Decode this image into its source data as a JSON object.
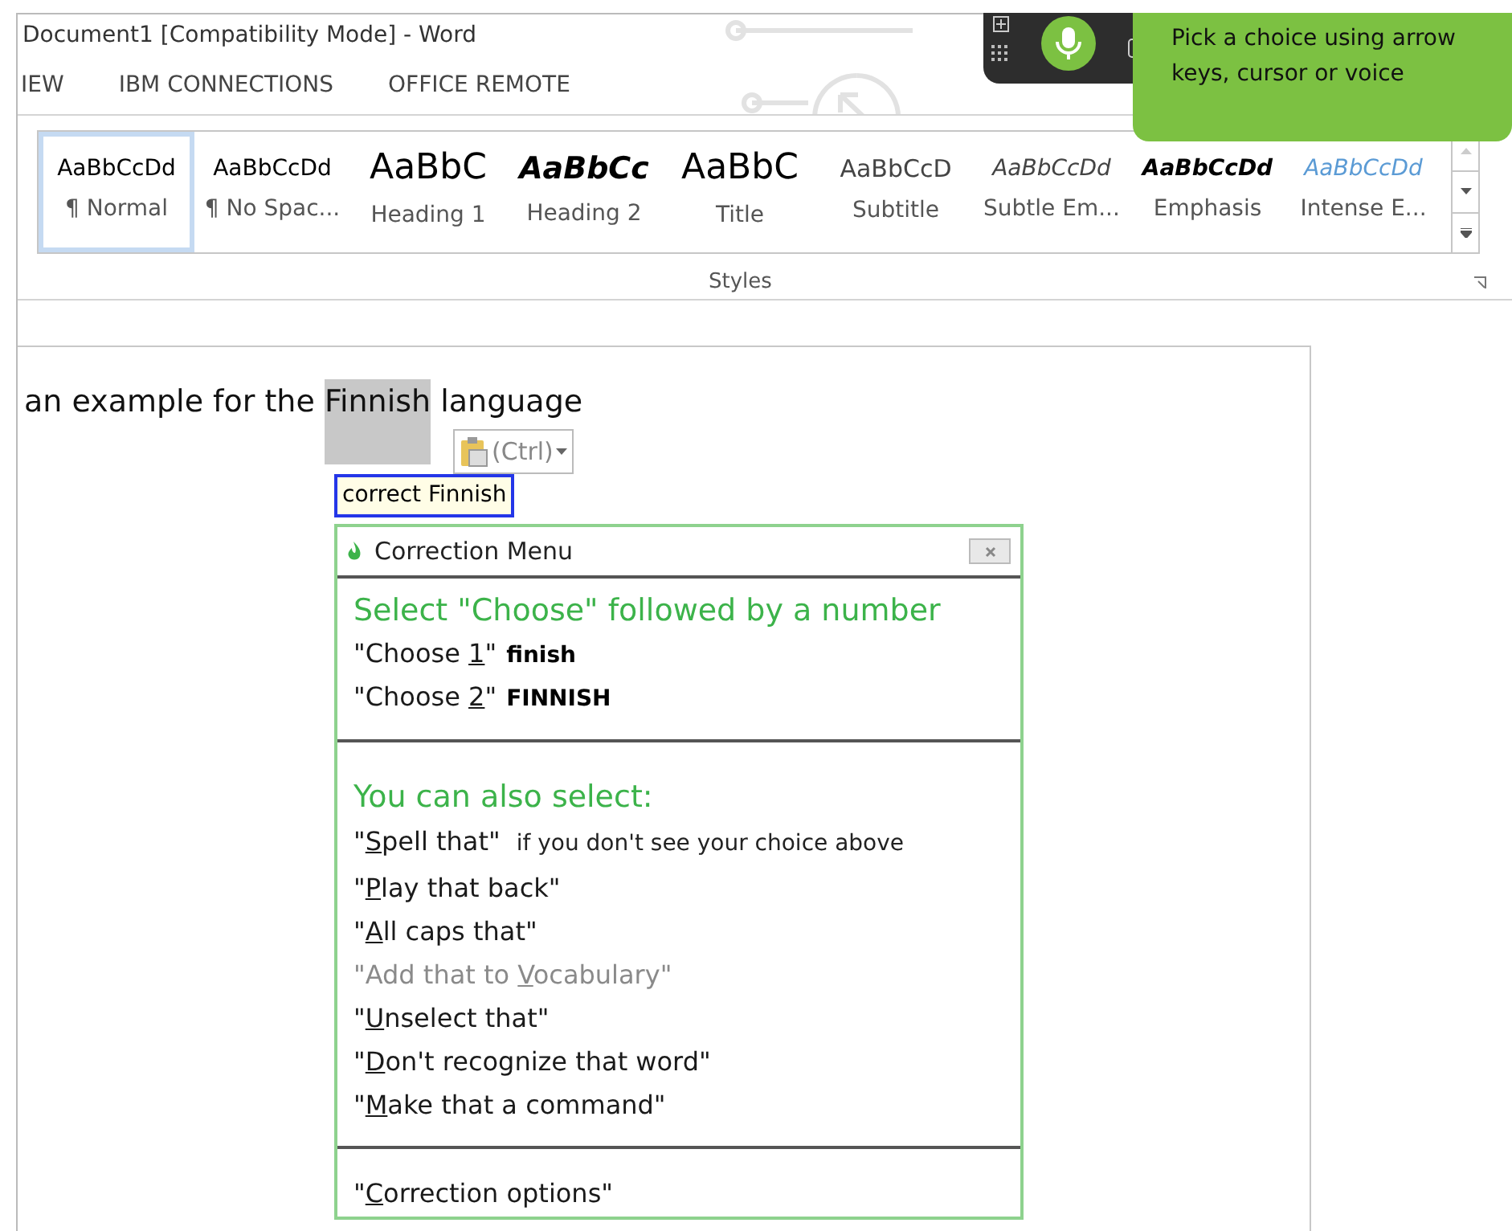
{
  "window": {
    "title": "Document1 [Compatibility Mode] - Word"
  },
  "ribbon_tabs": [
    {
      "label": "IEW",
      "selected": false
    },
    {
      "label": "IBM CONNECTIONS",
      "selected": false
    },
    {
      "label": "OFFICE REMOTE",
      "selected": false
    }
  ],
  "styles": {
    "group_label": "Styles",
    "items": [
      {
        "preview": "AaBbCcDd",
        "name": "¶ Normal",
        "kind": "normal",
        "selected": true
      },
      {
        "preview": "AaBbCcDd",
        "name": "¶ No Spac...",
        "kind": "normal",
        "selected": false
      },
      {
        "preview": "AaBbC",
        "name": "Heading 1",
        "kind": "heading1",
        "selected": false
      },
      {
        "preview": "AaBbCc",
        "name": "Heading 2",
        "kind": "heading2",
        "selected": false
      },
      {
        "preview": "AaBbC",
        "name": "Title",
        "kind": "title",
        "selected": false
      },
      {
        "preview": "AaBbCcD",
        "name": "Subtitle",
        "kind": "subtitle",
        "selected": false
      },
      {
        "preview": "AaBbCcDd",
        "name": "Subtle Em...",
        "kind": "subtle",
        "selected": false
      },
      {
        "preview": "AaBbCcDd",
        "name": "Emphasis",
        "kind": "emphasis",
        "selected": false
      },
      {
        "preview": "AaBbCcDd",
        "name": "Intense E...",
        "kind": "intense",
        "selected": false
      }
    ]
  },
  "voice_tooltip": {
    "text": "Pick a choice using arrow keys, cursor or voice"
  },
  "document": {
    "before": "an example for the ",
    "selected_word": "Finnish",
    "after": " language"
  },
  "paste_options": {
    "label": "(Ctrl)"
  },
  "command_tooltip": {
    "text": "correct Finnish"
  },
  "correction_menu": {
    "title": "Correction Menu",
    "choose_heading": "Select \"Choose\" followed by a number",
    "choices": [
      {
        "before": "\"Choose ",
        "key": "1",
        "after": "\"",
        "suggestion": "finish"
      },
      {
        "before": "\"Choose ",
        "key": "2",
        "after": "\"",
        "suggestion": "FINNISH"
      }
    ],
    "also_heading": "You can also select:",
    "commands": [
      {
        "before": "\"",
        "key": "S",
        "after": "pell that\"",
        "disabled": false,
        "note": "if you don't see your choice above"
      },
      {
        "before": "\"",
        "key": "P",
        "after": "lay that back\"",
        "disabled": false
      },
      {
        "before": "\"",
        "key": "A",
        "after": "ll caps that\"",
        "disabled": false
      },
      {
        "before": "\"Add that to ",
        "key": "V",
        "after": "ocabulary\"",
        "disabled": true
      },
      {
        "before": "\"",
        "key": "U",
        "after": "nselect that\"",
        "disabled": false
      },
      {
        "before": "\"",
        "key": "D",
        "after": "on't recognize that word\"",
        "disabled": false
      },
      {
        "before": "\"",
        "key": "M",
        "after": "ake that a command\"",
        "disabled": false
      }
    ],
    "footer_command": {
      "before": "\"",
      "key": "C",
      "after": "orrection options\""
    }
  }
}
